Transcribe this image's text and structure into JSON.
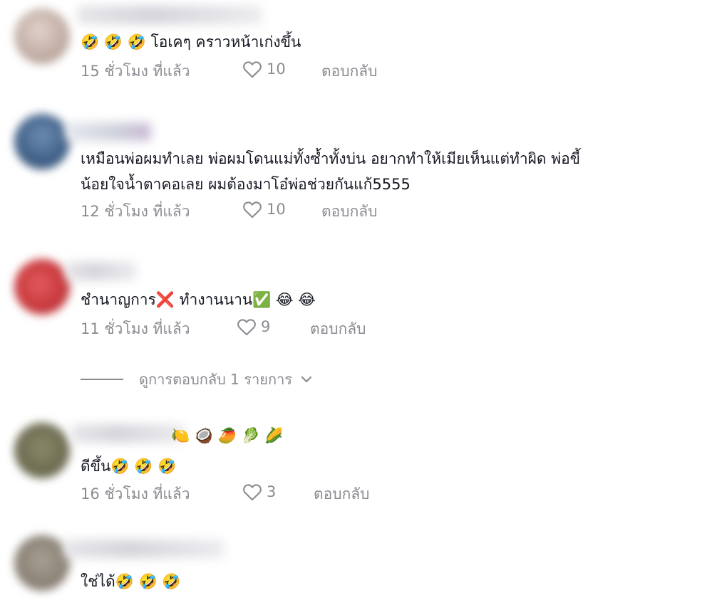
{
  "comments": [
    {
      "text": "🤣 🤣 🤣  โอเคๆ คราวหน้าเก่งขึ้น",
      "time": "15 ชั่วโมง ที่แล้ว",
      "likes": "10",
      "reply": "ตอบกลับ",
      "avatar_color": "#c9b7ad"
    },
    {
      "text": "เหมือนพ่อผมทำเลย พ่อผมโดนแม่ทั้งซ้ำทั้งบ่น อยากทำให้เมียเห็นแต่ทำผิด พ่อขี้",
      "text2": "น้อยใจน้ำตาคอเลย ผมต้องมาโอ๋พ่อช่วยกันแก้5555",
      "time": "12 ชั่วโมง ที่แล้ว",
      "likes": "10",
      "reply": "ตอบกลับ",
      "avatar_color": "#3f5f86"
    },
    {
      "text": "ชำนาญการ❌  ทำงานนาน✅   😂 😂",
      "time": "11 ชั่วโมง ที่แล้ว",
      "likes": "9",
      "reply": "ตอบกลับ",
      "avatar_color": "#c8393d"
    },
    {
      "name_emojis": "🍋 🥥 🥭 🥬 🌽",
      "text": "ดีขึ้น🤣 🤣 🤣",
      "time": "16 ชั่วโมง ที่แล้ว",
      "likes": "3",
      "reply": "ตอบกลับ",
      "avatar_color": "#6f6e53"
    },
    {
      "text": "ใช่ได้🤣 🤣 🤣",
      "avatar_color": "#8d8478"
    }
  ],
  "view_replies": {
    "label": "ดูการตอบกลับ 1 รายการ"
  },
  "colors": {
    "text": "#161823",
    "muted": "#8a8b91"
  },
  "icons": {
    "like": "heart-outline-icon",
    "expand": "chevron-down-icon"
  }
}
